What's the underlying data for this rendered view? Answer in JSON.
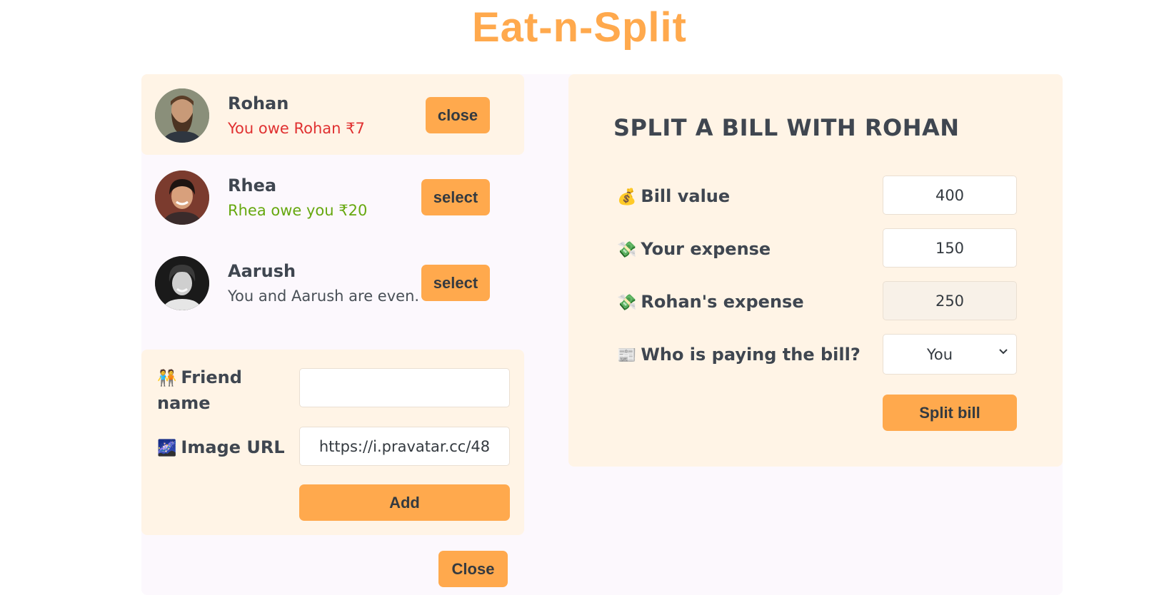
{
  "app": {
    "title": "Eat-n-Split"
  },
  "friends": [
    {
      "name": "Rohan",
      "balance": "You owe Rohan ₹7",
      "status": "owe",
      "button": "close",
      "selected": true
    },
    {
      "name": "Rhea",
      "balance": "Rhea owe you ₹20",
      "status": "owed",
      "button": "select",
      "selected": false
    },
    {
      "name": "Aarush",
      "balance": "You and Aarush are even.",
      "status": "even",
      "button": "select",
      "selected": false
    }
  ],
  "add_friend": {
    "name_emoji": "🧑‍🤝‍🧑",
    "name_label_line1": "Friend",
    "name_label_line2": "name",
    "name_value": "",
    "image_emoji": "🌌",
    "image_label": "Image URL",
    "image_value": "https://i.pravatar.cc/48",
    "add_button": "Add"
  },
  "close_form_button": "Close",
  "split": {
    "title": "SPLIT A BILL WITH ROHAN",
    "bill_emoji": "💰",
    "bill_label": "Bill value",
    "bill_value": "400",
    "your_emoji": "💸",
    "your_label": "Your expense",
    "your_value": "150",
    "friend_emoji": "💸",
    "friend_label": "Rohan's expense",
    "friend_value": "250",
    "payer_emoji": "📰",
    "payer_label": "Who is paying the bill?",
    "payer_value": "You",
    "split_button": "Split bill"
  },
  "colors": {
    "accent": "#ffa94d",
    "panel": "#fff4e6",
    "owe": "#e03131",
    "owed": "#66a80f"
  }
}
